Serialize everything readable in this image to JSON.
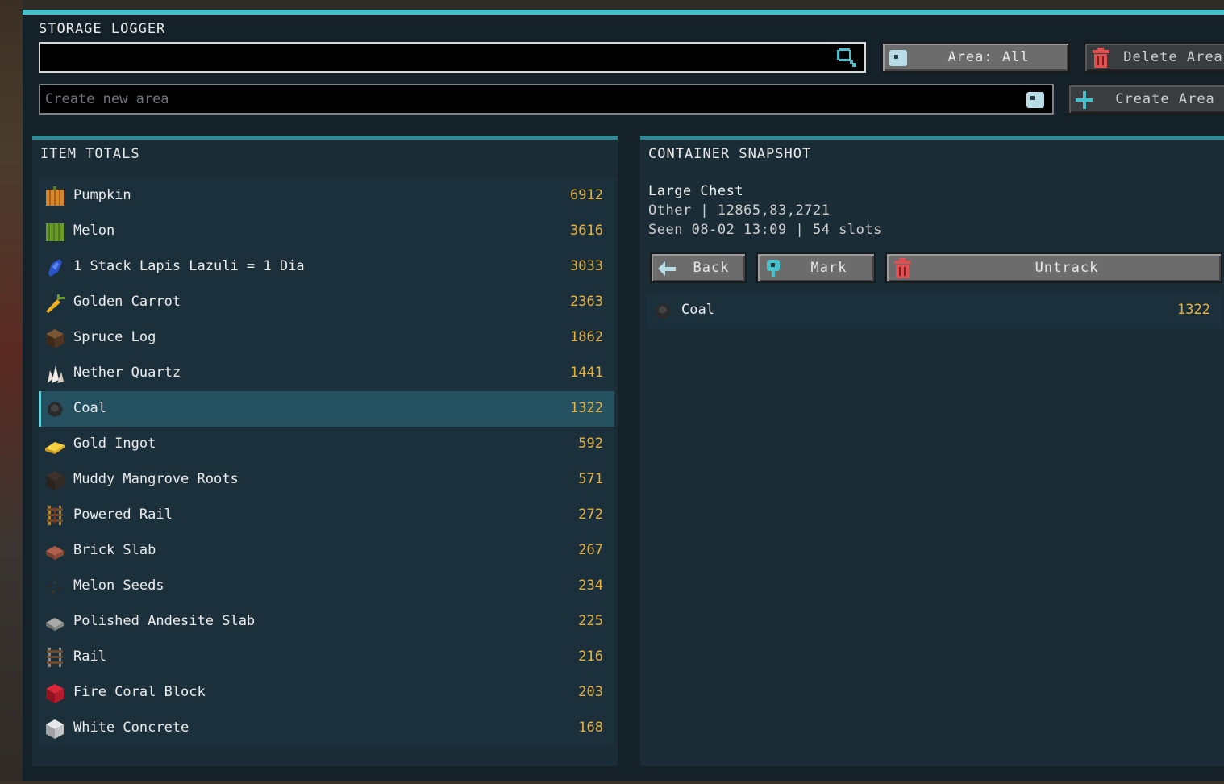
{
  "app": {
    "title": "STORAGE LOGGER"
  },
  "search": {
    "value": "",
    "placeholder": ""
  },
  "create_area": {
    "placeholder": "Create new area"
  },
  "buttons": {
    "area_filter": "Area: All",
    "delete_area": "Delete Area",
    "create_area": "Create Area",
    "back": "Back",
    "mark": "Mark",
    "untrack": "Untrack"
  },
  "item_totals": {
    "title": "ITEM TOTALS",
    "items": [
      {
        "name": "Pumpkin",
        "count": "6912",
        "icon": "pumpkin-icon"
      },
      {
        "name": "Melon",
        "count": "3616",
        "icon": "melon-icon"
      },
      {
        "name": "1 Stack Lapis Lazuli = 1 Dia",
        "count": "3033",
        "icon": "lapis-icon"
      },
      {
        "name": "Golden Carrot",
        "count": "2363",
        "icon": "golden-carrot-icon"
      },
      {
        "name": "Spruce Log",
        "count": "1862",
        "icon": "spruce-log-icon"
      },
      {
        "name": "Nether Quartz",
        "count": "1441",
        "icon": "quartz-icon"
      },
      {
        "name": "Coal",
        "count": "1322",
        "icon": "coal-icon",
        "selected": true
      },
      {
        "name": "Gold Ingot",
        "count": "592",
        "icon": "gold-ingot-icon"
      },
      {
        "name": "Muddy Mangrove Roots",
        "count": "571",
        "icon": "mangrove-roots-icon"
      },
      {
        "name": "Powered Rail",
        "count": "272",
        "icon": "powered-rail-icon"
      },
      {
        "name": "Brick Slab",
        "count": "267",
        "icon": "brick-slab-icon"
      },
      {
        "name": "Melon Seeds",
        "count": "234",
        "icon": "melon-seeds-icon"
      },
      {
        "name": "Polished Andesite Slab",
        "count": "225",
        "icon": "andesite-slab-icon"
      },
      {
        "name": "Rail",
        "count": "216",
        "icon": "rail-icon"
      },
      {
        "name": "Fire Coral Block",
        "count": "203",
        "icon": "fire-coral-icon"
      },
      {
        "name": "White Concrete",
        "count": "168",
        "icon": "white-concrete-icon"
      }
    ]
  },
  "snapshot": {
    "title": "CONTAINER SNAPSHOT",
    "container_name": "Large Chest",
    "location": "Other | 12865,83,2721",
    "seen": "Seen 08-02 13:09 | 54 slots",
    "items": [
      {
        "name": "Coal",
        "count": "1322",
        "icon": "coal-icon"
      }
    ]
  },
  "colors": {
    "accent": "#47c0cc",
    "count": "#e8b23a",
    "panel": "#1a2c36"
  }
}
